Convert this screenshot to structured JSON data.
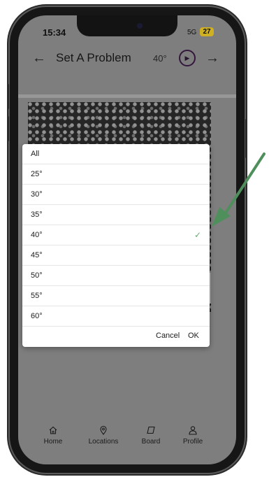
{
  "status": {
    "time": "15:34",
    "network": "5G",
    "battery": "27"
  },
  "header": {
    "title": "Set A Problem",
    "angle": "40°"
  },
  "dialog": {
    "options": [
      {
        "label": "All",
        "selected": false
      },
      {
        "label": "25°",
        "selected": false
      },
      {
        "label": "30°",
        "selected": false
      },
      {
        "label": "35°",
        "selected": false
      },
      {
        "label": "40°",
        "selected": true
      },
      {
        "label": "45°",
        "selected": false
      },
      {
        "label": "50°",
        "selected": false
      },
      {
        "label": "55°",
        "selected": false
      },
      {
        "label": "60°",
        "selected": false
      }
    ],
    "check_glyph": "✓",
    "cancel_label": "Cancel",
    "ok_label": "OK"
  },
  "nav": {
    "items": [
      {
        "label": "Home",
        "icon": "home-icon"
      },
      {
        "label": "Locations",
        "icon": "location-pin-icon"
      },
      {
        "label": "Board",
        "icon": "board-icon"
      },
      {
        "label": "Profile",
        "icon": "profile-icon"
      }
    ]
  },
  "colors": {
    "annotation_arrow": "#4f8f5c",
    "check": "#6fa77b",
    "play_ring": "#3a1a44",
    "battery": "#e8c428"
  }
}
